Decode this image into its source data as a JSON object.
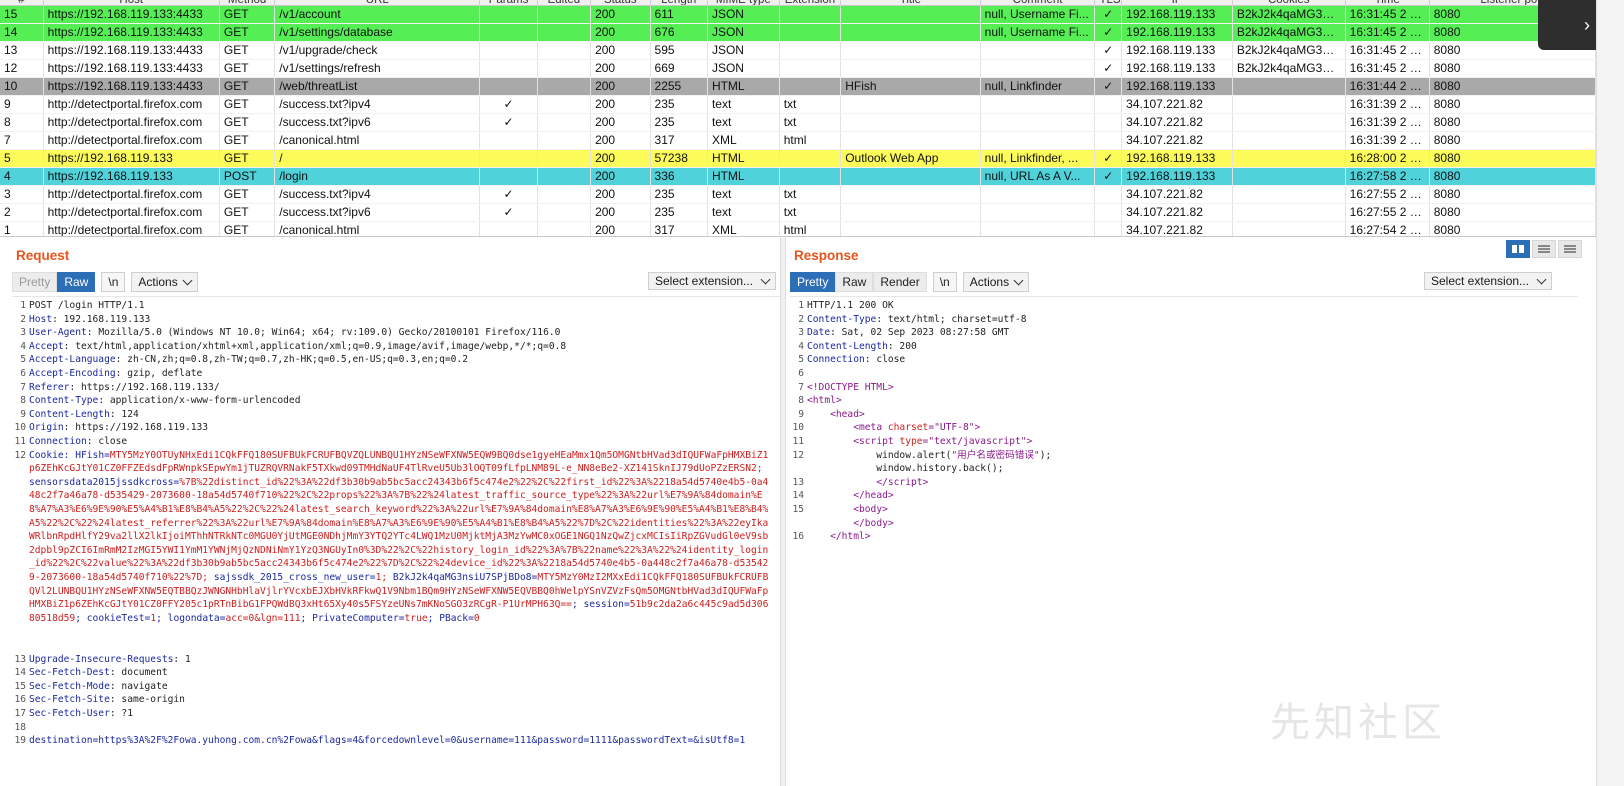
{
  "history": {
    "columns": [
      "#",
      "Host",
      "Method",
      "URL",
      "Params",
      "Edited",
      "Status",
      "Length",
      "MIME type",
      "Extension",
      "Title",
      "Comment",
      "TLS",
      "IP",
      "Cookies",
      "Time",
      "Listener port"
    ],
    "rows": [
      {
        "id": "15",
        "host": "https://192.168.119.133:4433",
        "method": "GET",
        "url": "/v1/account",
        "params": "",
        "edited": "",
        "status": "200",
        "length": "611",
        "mime": "JSON",
        "ext": "",
        "title": "",
        "comment": "null, Username Fi...",
        "tls": "✓",
        "ip": "192.168.119.133",
        "cookies": "B2kJ2k4qaMG3ns...",
        "time": "16:31:45 2 9...",
        "port": "8080",
        "hl": "hl-green"
      },
      {
        "id": "14",
        "host": "https://192.168.119.133:4433",
        "method": "GET",
        "url": "/v1/settings/database",
        "params": "",
        "edited": "",
        "status": "200",
        "length": "676",
        "mime": "JSON",
        "ext": "",
        "title": "",
        "comment": "null, Username Fi...",
        "tls": "✓",
        "ip": "192.168.119.133",
        "cookies": "B2kJ2k4qaMG3ns...",
        "time": "16:31:45 2 9...",
        "port": "8080",
        "hl": "hl-green"
      },
      {
        "id": "13",
        "host": "https://192.168.119.133:4433",
        "method": "GET",
        "url": "/v1/upgrade/check",
        "params": "",
        "edited": "",
        "status": "200",
        "length": "595",
        "mime": "JSON",
        "ext": "",
        "title": "",
        "comment": "",
        "tls": "✓",
        "ip": "192.168.119.133",
        "cookies": "B2kJ2k4qaMG3ns...",
        "time": "16:31:45 2 9...",
        "port": "8080",
        "hl": ""
      },
      {
        "id": "12",
        "host": "https://192.168.119.133:4433",
        "method": "GET",
        "url": "/v1/settings/refresh",
        "params": "",
        "edited": "",
        "status": "200",
        "length": "669",
        "mime": "JSON",
        "ext": "",
        "title": "",
        "comment": "",
        "tls": "✓",
        "ip": "192.168.119.133",
        "cookies": "B2kJ2k4qaMG3ns...",
        "time": "16:31:45 2 9...",
        "port": "8080",
        "hl": ""
      },
      {
        "id": "10",
        "host": "https://192.168.119.133:4433",
        "method": "GET",
        "url": "/web/threatList",
        "params": "",
        "edited": "",
        "status": "200",
        "length": "2255",
        "mime": "HTML",
        "ext": "",
        "title": "HFish",
        "comment": "null, Linkfinder",
        "tls": "✓",
        "ip": "192.168.119.133",
        "cookies": "",
        "time": "16:31:44 2 9...",
        "port": "8080",
        "hl": "hl-gray"
      },
      {
        "id": "9",
        "host": "http://detectportal.firefox.com",
        "method": "GET",
        "url": "/success.txt?ipv4",
        "params": "✓",
        "edited": "",
        "status": "200",
        "length": "235",
        "mime": "text",
        "ext": "txt",
        "title": "",
        "comment": "",
        "tls": "",
        "ip": "34.107.221.82",
        "cookies": "",
        "time": "16:31:39 2 9...",
        "port": "8080",
        "hl": ""
      },
      {
        "id": "8",
        "host": "http://detectportal.firefox.com",
        "method": "GET",
        "url": "/success.txt?ipv6",
        "params": "✓",
        "edited": "",
        "status": "200",
        "length": "235",
        "mime": "text",
        "ext": "txt",
        "title": "",
        "comment": "",
        "tls": "",
        "ip": "34.107.221.82",
        "cookies": "",
        "time": "16:31:39 2 9...",
        "port": "8080",
        "hl": ""
      },
      {
        "id": "7",
        "host": "http://detectportal.firefox.com",
        "method": "GET",
        "url": "/canonical.html",
        "params": "",
        "edited": "",
        "status": "200",
        "length": "317",
        "mime": "XML",
        "ext": "html",
        "title": "",
        "comment": "",
        "tls": "",
        "ip": "34.107.221.82",
        "cookies": "",
        "time": "16:31:39 2 9...",
        "port": "8080",
        "hl": ""
      },
      {
        "id": "5",
        "host": "https://192.168.119.133",
        "method": "GET",
        "url": "/",
        "params": "",
        "edited": "",
        "status": "200",
        "length": "57238",
        "mime": "HTML",
        "ext": "",
        "title": "Outlook Web App",
        "comment": "null, Linkfinder, ...",
        "tls": "✓",
        "ip": "192.168.119.133",
        "cookies": "",
        "time": "16:28:00 2 9...",
        "port": "8080",
        "hl": "hl-yellow"
      },
      {
        "id": "4",
        "host": "https://192.168.119.133",
        "method": "POST",
        "url": "/login",
        "params": "",
        "edited": "",
        "status": "200",
        "length": "336",
        "mime": "HTML",
        "ext": "",
        "title": "",
        "comment": "null, URL As A V...",
        "tls": "✓",
        "ip": "192.168.119.133",
        "cookies": "",
        "time": "16:27:58 2 9...",
        "port": "8080",
        "hl": "hl-cyan"
      },
      {
        "id": "3",
        "host": "http://detectportal.firefox.com",
        "method": "GET",
        "url": "/success.txt?ipv4",
        "params": "✓",
        "edited": "",
        "status": "200",
        "length": "235",
        "mime": "text",
        "ext": "txt",
        "title": "",
        "comment": "",
        "tls": "",
        "ip": "34.107.221.82",
        "cookies": "",
        "time": "16:27:55 2 9...",
        "port": "8080",
        "hl": ""
      },
      {
        "id": "2",
        "host": "http://detectportal.firefox.com",
        "method": "GET",
        "url": "/success.txt?ipv6",
        "params": "✓",
        "edited": "",
        "status": "200",
        "length": "235",
        "mime": "text",
        "ext": "txt",
        "title": "",
        "comment": "",
        "tls": "",
        "ip": "34.107.221.82",
        "cookies": "",
        "time": "16:27:55 2 9...",
        "port": "8080",
        "hl": ""
      },
      {
        "id": "1",
        "host": "http://detectportal.firefox.com",
        "method": "GET",
        "url": "/canonical.html",
        "params": "",
        "edited": "",
        "status": "200",
        "length": "317",
        "mime": "XML",
        "ext": "html",
        "title": "",
        "comment": "",
        "tls": "",
        "ip": "34.107.221.82",
        "cookies": "",
        "time": "16:27:54 2 9...",
        "port": "8080",
        "hl": ""
      }
    ]
  },
  "request": {
    "title": "Request",
    "tabs": {
      "pretty": "Pretty",
      "raw": "Raw",
      "newline": "\\n",
      "actions": "Actions"
    },
    "select_extension": "Select extension...",
    "lines": [
      {
        "n": "1",
        "k": "",
        "v": "POST /login HTTP/1.1"
      },
      {
        "n": "2",
        "k": "Host",
        "v": ": 192.168.119.133"
      },
      {
        "n": "3",
        "k": "User-Agent",
        "v": ": Mozilla/5.0 (Windows NT 10.0; Win64; x64; rv:109.0) Gecko/20100101 Firefox/116.0"
      },
      {
        "n": "4",
        "k": "Accept",
        "v": ": text/html,application/xhtml+xml,application/xml;q=0.9,image/avif,image/webp,*/*;q=0.8"
      },
      {
        "n": "5",
        "k": "Accept-Language",
        "v": ": zh-CN,zh;q=0.8,zh-TW;q=0.7,zh-HK;q=0.5,en-US;q=0.3,en;q=0.2"
      },
      {
        "n": "6",
        "k": "Accept-Encoding",
        "v": ": gzip, deflate"
      },
      {
        "n": "7",
        "k": "Referer",
        "v": ": https://192.168.119.133/"
      },
      {
        "n": "8",
        "k": "Content-Type",
        "v": ": application/x-www-form-urlencoded"
      },
      {
        "n": "9",
        "k": "Content-Length",
        "v": ": 124"
      },
      {
        "n": "10",
        "k": "Origin",
        "v": ": https://192.168.119.133"
      },
      {
        "n": "11",
        "k": "Connection",
        "v": ": close"
      }
    ],
    "cookie_line": {
      "n": "12",
      "k": "Cookie",
      "segments": [
        {
          "c": "hk",
          "t": ": "
        },
        {
          "c": "bd",
          "t": "HFish"
        },
        {
          "c": "hk",
          "t": "="
        },
        {
          "c": "ck",
          "t": "MTY5MzY0OTUyNHxEdi1CQkFFQ180SUFBUkFCRUFBQVZQLUNBQU1HYzNSeWFXNW5EQW9BQ0dse1gyeHEaMmx1Qm5OMGNtbHVad3dIQUFWaFpHMXBiZ1p6ZEhKcGJtY01CZ0FFZEdsdFpRWnpkSEpwYm1jTUZRQVRNakF5TXkwd09TMHdNaUF4TlRveU5Ub3lOQT09fLfpLNM89L-e_NN8eBe2-XZ141SknIJ79dUoPZzERSN2; "
        },
        {
          "c": "bd",
          "t": "sensorsdata2015jssdkcross"
        },
        {
          "c": "hk",
          "t": "="
        },
        {
          "c": "ck",
          "t": "%7B%22distinct_id%22%3A%22df3b30b9ab5bc5acc24343b6f5c474e2%22%2C%22first_id%22%3A%2218a54d5740e4b5-0a448c2f7a46a78-d535429-2073600-18a54d5740f710%22%2C%22props%22%3A%7B%22%24latest_traffic_source_type%22%3A%22url%E7%9A%84domain%E8%A7%A3%E6%9E%90%E5%A4%B1%E8%B4%A5%22%2C%22%24latest_search_keyword%22%3A%22url%E7%9A%84domain%E8%A7%A3%E6%9E%90%E5%A4%B1%E8%B4%A5%22%2C%22%24latest_referrer%22%3A%22url%E7%9A%84domain%E8%A7%A3%E6%9E%90%E5%A4%B1%E8%B4%A5%22%7D%2C%22identities%22%3A%22eyIkaWRlbnRpdHlfY29va2llX2lkIjoiMThhNTRkNTc0MGU0YjUtMGE0NDhjMmY3YTQ2YTc4LWQ1MzU0MjktMjA3MzYwMC0xOGE1NGQ1NzQwZjcxMCIsIiRpZGVudGl0eV9sb2dpbl9pZCI6ImRmM2IzMGI5YWI1YmM1YWNjMjQzNDNiNmY1YzQ3NGUyIn0%3D%22%2C%22history_login_id%22%3A%7B%22name%22%3A%22%24identity_login_id%22%2C%22value%22%3A%22df3b30b9ab5bc5acc24343b6f5c474e2%22%7D%2C%22%24device_id%22%3A%2218a54d5740e4b5-0a448c2f7a46a78-d535429-2073600-18a54d5740f710%22%7D; "
        },
        {
          "c": "bd",
          "t": "sajssdk_2015_cross_new_user"
        },
        {
          "c": "hk",
          "t": "="
        },
        {
          "c": "ck",
          "t": "1; "
        },
        {
          "c": "bd",
          "t": "B2kJ2k4qaMG3nsiU7SPjBDo8"
        },
        {
          "c": "hk",
          "t": "="
        },
        {
          "c": "ck",
          "t": "MTY5MzY0MzI2MXxEdi1CQkFFQ180SUFBUkFCRUFBQVl2LUNBQU1HYzNSeWFXNW5EQTBBQzJWNGNHbHlaVjlrYVcxbEJXbHVkRFkwQ1V9Nbm1BQm9HYzNSeWFXNW5EQVBBQ0hWelpYSnVZVzFsQm5OMGNtbHVad3dIQUFWaFpHMXBiZ1p6ZEhKcGJtY01CZ0FFY205c1pRTnBibG1FPQWdBQ3xHt65Xy40s5FSYzeUNs7mKNoSGO3zRCgR-P1UrMPH63Q=="
        },
        {
          "c": "hk",
          "t": "; "
        },
        {
          "c": "bd",
          "t": "session"
        },
        {
          "c": "hk",
          "t": "="
        },
        {
          "c": "ck",
          "t": "51b9c2da2a6c445c9ad5d30680518d59"
        },
        {
          "c": "hk",
          "t": "; "
        },
        {
          "c": "bd",
          "t": "cookieTest"
        },
        {
          "c": "hk",
          "t": "="
        },
        {
          "c": "ck",
          "t": "1"
        },
        {
          "c": "hk",
          "t": "; "
        },
        {
          "c": "bd",
          "t": "logondata"
        },
        {
          "c": "hk",
          "t": "="
        },
        {
          "c": "ck",
          "t": "acc=0&lgn=111"
        },
        {
          "c": "hk",
          "t": "; "
        },
        {
          "c": "bd",
          "t": "PrivateComputer"
        },
        {
          "c": "hk",
          "t": "="
        },
        {
          "c": "ck",
          "t": "true"
        },
        {
          "c": "hk",
          "t": "; "
        },
        {
          "c": "bd",
          "t": "PBack"
        },
        {
          "c": "hk",
          "t": "="
        },
        {
          "c": "ck",
          "t": "0"
        }
      ]
    },
    "lines_after": [
      {
        "n": "13",
        "k": "Upgrade-Insecure-Requests",
        "v": ": 1"
      },
      {
        "n": "14",
        "k": "Sec-Fetch-Dest",
        "v": ": document"
      },
      {
        "n": "15",
        "k": "Sec-Fetch-Mode",
        "v": ": navigate"
      },
      {
        "n": "16",
        "k": "Sec-Fetch-Site",
        "v": ": same-origin"
      },
      {
        "n": "17",
        "k": "Sec-Fetch-User",
        "v": ": ?1"
      },
      {
        "n": "18",
        "k": "",
        "v": ""
      }
    ],
    "body_line": {
      "n": "19",
      "v": "destination=https%3A%2F%2Fowa.yuhong.com.cn%2Fowa&flags=4&forcedownlevel=0&username=111&password=1111&passwordText=&isUtf8=1"
    }
  },
  "response": {
    "title": "Response",
    "tabs": {
      "pretty": "Pretty",
      "raw": "Raw",
      "render": "Render",
      "newline": "\\n",
      "actions": "Actions"
    },
    "select_extension": "Select extension...",
    "header_lines": [
      {
        "n": "1",
        "k": "",
        "v": "HTTP/1.1 200 OK"
      },
      {
        "n": "2",
        "k": "Content-Type",
        "v": ": text/html; charset=utf-8"
      },
      {
        "n": "3",
        "k": "Date",
        "v": ": Sat, 02 Sep 2023 08:27:58 GMT"
      },
      {
        "n": "4",
        "k": "Content-Length",
        "v": ": 200"
      },
      {
        "n": "5",
        "k": "Connection",
        "v": ": close"
      },
      {
        "n": "6",
        "k": "",
        "v": ""
      }
    ],
    "html_lines": [
      {
        "n": "7",
        "indent": "",
        "html": "<span class='tag'>&lt;!DOCTYPE HTML&gt;</span>"
      },
      {
        "n": "8",
        "indent": "",
        "html": "<span class='tag'>&lt;html&gt;</span>"
      },
      {
        "n": "9",
        "indent": "  ",
        "html": "<span class='tag'>&lt;head&gt;</span>"
      },
      {
        "n": "10",
        "indent": "    ",
        "html": "<span class='tag'>&lt;meta </span><span class='attr'>charset</span><span class='tag'>=</span><span class='str'>\"UTF-8\"</span><span class='tag'>&gt;</span>"
      },
      {
        "n": "11",
        "indent": "    ",
        "html": "<span class='tag'>&lt;script </span><span class='attr'>type</span><span class='tag'>=</span><span class='str'>\"text/javascript\"</span><span class='tag'>&gt;</span>"
      },
      {
        "n": "12",
        "indent": "      ",
        "html": "window.alert(<span class='str'>\"用户名或密码错误\"</span>);"
      },
      {
        "n": "",
        "indent": "      ",
        "html": "window.history.back();"
      },
      {
        "n": "13",
        "indent": "      ",
        "html": "<span class='tag'>&lt;/script&gt;</span>"
      },
      {
        "n": "14",
        "indent": "    ",
        "html": "<span class='tag'>&lt;/head&gt;</span>"
      },
      {
        "n": "15",
        "indent": "    ",
        "html": "<span class='tag'>&lt;body&gt;</span>"
      },
      {
        "n": "",
        "indent": "    ",
        "html": "<span class='tag'>&lt;/body&gt;</span>"
      },
      {
        "n": "16",
        "indent": "  ",
        "html": "<span class='tag'>&lt;/html&gt;</span>"
      }
    ]
  },
  "watermark": "先知社区"
}
